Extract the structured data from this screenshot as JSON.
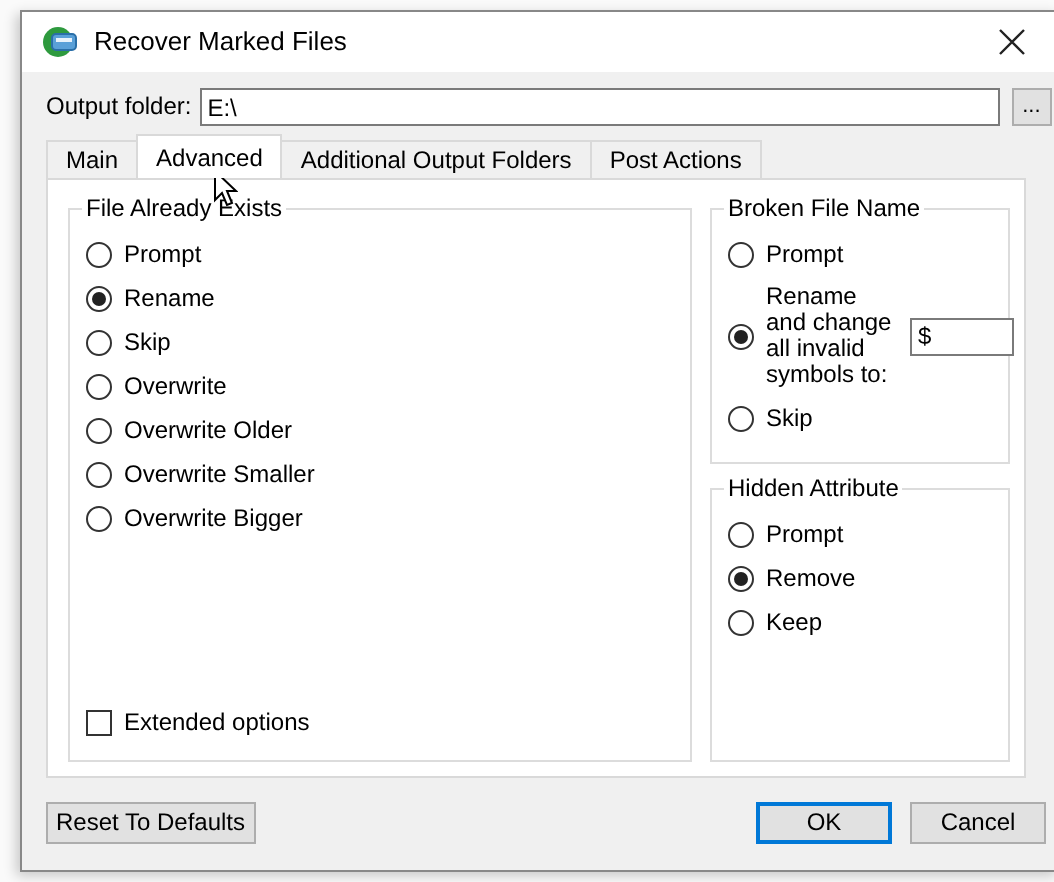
{
  "window": {
    "title": "Recover Marked Files"
  },
  "output_folder": {
    "label": "Output folder:",
    "value": "E:\\",
    "browse_button": "..."
  },
  "tabs": [
    {
      "label": "Main",
      "selected": false
    },
    {
      "label": "Advanced",
      "selected": true
    },
    {
      "label": "Additional Output Folders",
      "selected": false
    },
    {
      "label": "Post Actions",
      "selected": false
    }
  ],
  "file_already_exists": {
    "title": "File Already Exists",
    "options": [
      {
        "label": "Prompt",
        "selected": false
      },
      {
        "label": "Rename",
        "selected": true
      },
      {
        "label": "Skip",
        "selected": false
      },
      {
        "label": "Overwrite",
        "selected": false
      },
      {
        "label": "Overwrite Older",
        "selected": false
      },
      {
        "label": "Overwrite Smaller",
        "selected": false
      },
      {
        "label": "Overwrite Bigger",
        "selected": false
      }
    ],
    "extended_options": {
      "label": "Extended options",
      "checked": false
    }
  },
  "broken_file_name": {
    "title": "Broken File Name",
    "options": [
      {
        "label": "Prompt",
        "selected": false,
        "kind": "plain"
      },
      {
        "label": "Rename and change all invalid symbols to:",
        "selected": true,
        "kind": "with-field",
        "value": "$"
      },
      {
        "label": "Skip",
        "selected": false,
        "kind": "plain"
      }
    ]
  },
  "hidden_attribute": {
    "title": "Hidden Attribute",
    "options": [
      {
        "label": "Prompt",
        "selected": false
      },
      {
        "label": "Remove",
        "selected": true
      },
      {
        "label": "Keep",
        "selected": false
      }
    ]
  },
  "buttons": [
    {
      "label": "Reset To Defaults",
      "kind": "reset"
    },
    {
      "label": "OK",
      "kind": "default"
    },
    {
      "label": "Cancel",
      "kind": "normal"
    }
  ]
}
